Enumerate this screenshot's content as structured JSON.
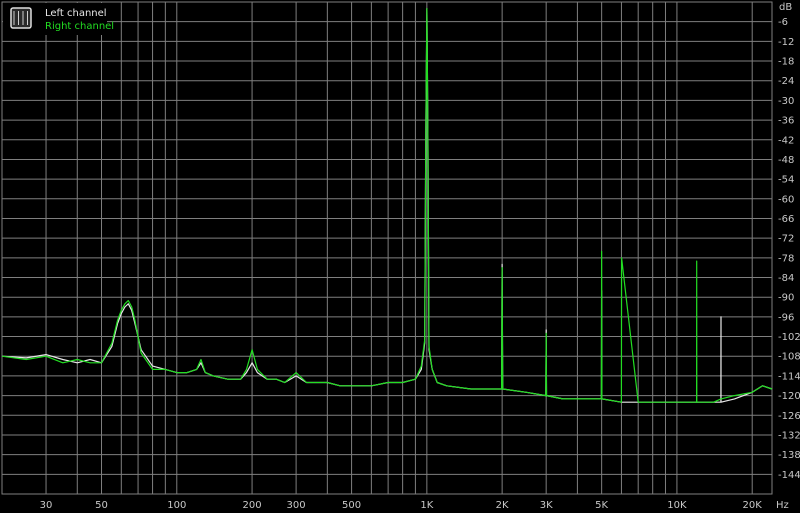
{
  "legend": {
    "left_label": "Left channel",
    "right_label": "Right channel"
  },
  "axis": {
    "y_unit": "dB",
    "x_unit": "Hz"
  },
  "colors": {
    "background": "#000000",
    "grid": "#7f7f7f",
    "left_channel": "#e8e8e8",
    "right_channel": "#22dd22",
    "tick_text": "#c8c8c8"
  },
  "chart_data": {
    "type": "line",
    "xscale": "log",
    "xlim": [
      20,
      24000
    ],
    "ylim": [
      -150,
      0
    ],
    "grid": true,
    "legend_position": "top-left",
    "xticks": [
      {
        "value": 30,
        "label": "30"
      },
      {
        "value": 50,
        "label": "50"
      },
      {
        "value": 100,
        "label": "100"
      },
      {
        "value": 200,
        "label": "200"
      },
      {
        "value": 300,
        "label": "300"
      },
      {
        "value": 500,
        "label": "500"
      },
      {
        "value": 1000,
        "label": "1K"
      },
      {
        "value": 2000,
        "label": "2K"
      },
      {
        "value": 3000,
        "label": "3K"
      },
      {
        "value": 5000,
        "label": "5K"
      },
      {
        "value": 10000,
        "label": "10K"
      },
      {
        "value": 20000,
        "label": "20K"
      }
    ],
    "yticks": [
      -6,
      -12,
      -18,
      -24,
      -30,
      -36,
      -42,
      -48,
      -54,
      -60,
      -66,
      -72,
      -78,
      -84,
      -90,
      -96,
      -102,
      -108,
      -114,
      -120,
      -126,
      -132,
      -138,
      -144
    ],
    "series": [
      {
        "name": "Left channel",
        "color": "#e8e8e8",
        "x": [
          20,
          25,
          30,
          35,
          40,
          45,
          50,
          55,
          58,
          60,
          62,
          64,
          66,
          68,
          72,
          80,
          90,
          100,
          110,
          120,
          125,
          130,
          140,
          160,
          180,
          190,
          200,
          210,
          230,
          250,
          270,
          300,
          330,
          350,
          400,
          450,
          500,
          600,
          700,
          800,
          900,
          950,
          980,
          990,
          1000,
          1010,
          1020,
          1050,
          1100,
          1200,
          1500,
          1990,
          2000,
          2010,
          2500,
          2990,
          3000,
          3010,
          3500,
          4000,
          4990,
          5000,
          5010,
          6000,
          7000,
          8000,
          10000,
          12000,
          14990,
          15000,
          15010,
          17000,
          20000,
          22000,
          24000
        ],
        "y": [
          -108,
          -108.5,
          -107.5,
          -109,
          -110,
          -109,
          -110,
          -105,
          -98,
          -95,
          -93,
          -92,
          -94,
          -98,
          -106,
          -111,
          -112,
          -113,
          -113,
          -112,
          -110,
          -113,
          -114,
          -115,
          -115,
          -113,
          -110,
          -113,
          -115,
          -115,
          -116,
          -114,
          -116,
          -116,
          -116,
          -117,
          -117,
          -117,
          -116,
          -116,
          -115,
          -112,
          -104,
          -40,
          -2,
          -40,
          -106,
          -112,
          -116,
          -117,
          -118,
          -118,
          -80,
          -118,
          -119,
          -120,
          -100,
          -120,
          -121,
          -121,
          -121,
          -88,
          -121,
          -122,
          -122,
          -122,
          -122,
          -122,
          -122,
          -96,
          -122,
          -121,
          -119,
          -117,
          -118
        ]
      },
      {
        "name": "Right channel",
        "color": "#22dd22",
        "x": [
          20,
          25,
          30,
          35,
          40,
          45,
          50,
          55,
          58,
          60,
          62,
          64,
          66,
          68,
          72,
          80,
          90,
          100,
          110,
          120,
          125,
          130,
          140,
          160,
          180,
          190,
          200,
          210,
          230,
          250,
          270,
          300,
          330,
          350,
          400,
          450,
          500,
          600,
          700,
          800,
          900,
          950,
          980,
          990,
          1000,
          1010,
          1020,
          1050,
          1100,
          1200,
          1500,
          1990,
          2000,
          2010,
          2500,
          2990,
          3000,
          3010,
          3500,
          4000,
          4990,
          5000,
          5010,
          6000,
          6010,
          7000,
          8000,
          9000,
          10000,
          11990,
          12000,
          12010,
          14000,
          15000,
          17000,
          20000,
          22000,
          24000
        ],
        "y": [
          -108,
          -109,
          -108,
          -110,
          -109,
          -110,
          -110,
          -104,
          -97,
          -94,
          -92,
          -91,
          -93,
          -97,
          -107,
          -112,
          -112,
          -113,
          -113,
          -112,
          -109,
          -113,
          -114,
          -115,
          -115,
          -112,
          -106,
          -112,
          -115,
          -115,
          -116,
          -113,
          -116,
          -116,
          -116,
          -117,
          -117,
          -117,
          -116,
          -116,
          -115,
          -111,
          -103,
          -40,
          -2,
          -40,
          -105,
          -112,
          -116,
          -117,
          -118,
          -118,
          -81,
          -118,
          -119,
          -120,
          -101,
          -120,
          -121,
          -121,
          -121,
          -76,
          -121,
          -122,
          -78,
          -122,
          -122,
          -122,
          -122,
          -122,
          -79,
          -122,
          -122,
          -121,
          -120,
          -119,
          -117,
          -118
        ]
      }
    ]
  }
}
